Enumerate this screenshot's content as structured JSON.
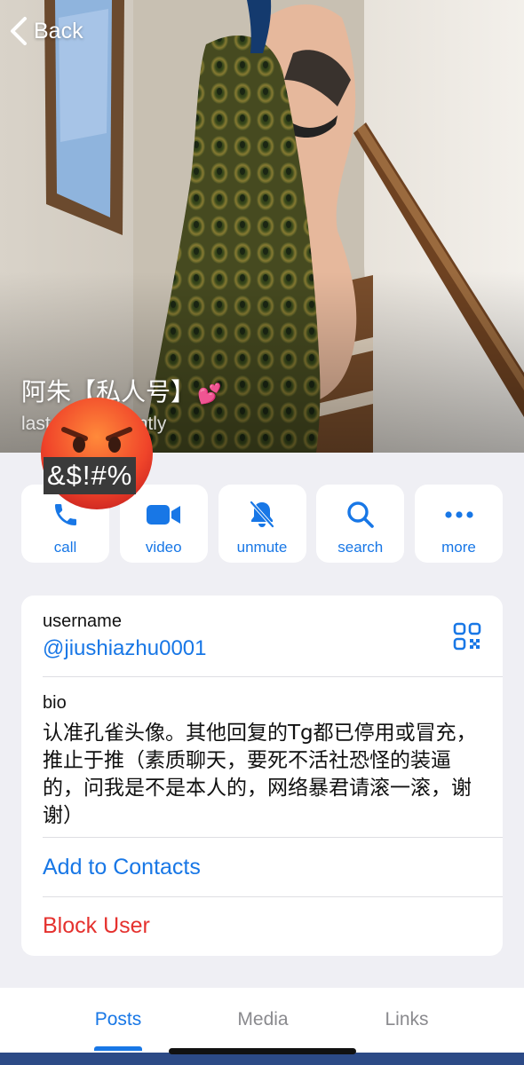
{
  "nav": {
    "back_label": "Back"
  },
  "profile": {
    "name": "阿朱【私人号】",
    "name_emoji": "💕",
    "status": "last seen recently",
    "censor_text": "&$!#%"
  },
  "actions": [
    {
      "label": "call",
      "icon": "phone-icon"
    },
    {
      "label": "video",
      "icon": "video-camera-icon"
    },
    {
      "label": "unmute",
      "icon": "bell-slash-icon"
    },
    {
      "label": "search",
      "icon": "magnifier-icon"
    },
    {
      "label": "more",
      "icon": "ellipsis-icon"
    }
  ],
  "info": {
    "username_caption": "username",
    "username": "@jiushiazhu0001",
    "bio_caption": "bio",
    "bio": "认准孔雀头像。其他回复的Tg都已停用或冒充，推止于推（素质聊天，要死不活社恐怪的装逼的，问我是不是本人的，网络暴君请滚一滚，谢谢）",
    "add_contact": "Add to Contacts",
    "block_user": "Block User"
  },
  "tabs": [
    {
      "label": "Posts",
      "active": true
    },
    {
      "label": "Media",
      "active": false
    },
    {
      "label": "Links",
      "active": false
    }
  ],
  "colors": {
    "accent": "#1877e6",
    "danger": "#e5312e",
    "background": "#efeff4"
  }
}
